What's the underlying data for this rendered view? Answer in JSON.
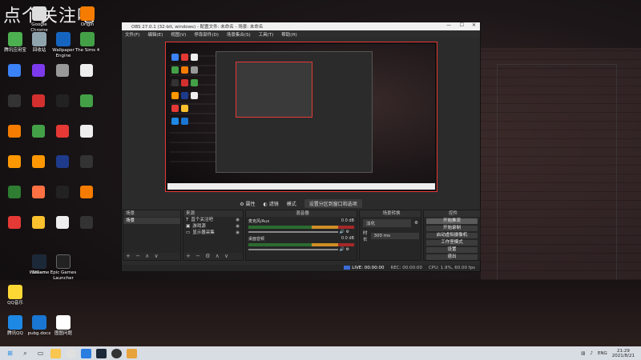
{
  "watermark": "点个关注吧",
  "obs": {
    "title": "OBS 27.0.1 (32-bit, windows) - 配置文件: 未命名 - 场景: 未命名",
    "menu": [
      "文件(F)",
      "编辑(E)",
      "视图(V)",
      "停靠部件(D)",
      "场景集合(S)",
      "工具(T)",
      "帮助(H)"
    ],
    "midbar": [
      "属性",
      "滤镜",
      "模式",
      "设置分区到窗口和选项"
    ],
    "scenes": {
      "header": "场景",
      "items": [
        "场景"
      ],
      "footer": "+ − ∧ ∨"
    },
    "sources": {
      "header": "来源",
      "items": [
        "直个关注吧",
        "游戏源",
        "显示器采集"
      ],
      "footer": "+ − ⚙ ∧ ∨"
    },
    "mixer": {
      "header": "混音器",
      "tracks": [
        {
          "name": "麦克风/Aux",
          "db": "0.0 dB"
        },
        {
          "name": "桌面音频",
          "db": "0.0 dB"
        }
      ]
    },
    "transitions": {
      "header": "场景转换",
      "type": "淡化",
      "duration_label": "时长",
      "duration": "300 ms"
    },
    "controls": {
      "header": "控件",
      "buttons": [
        "开始推流",
        "开始录制",
        "启动虚拟摄像机",
        "工作室模式",
        "设置",
        "退出"
      ]
    },
    "status": {
      "live": "LIVE: 00:00:00",
      "rec": "REC: 00:00:00",
      "cpu": "CPU: 1.9%, 60.00 fps"
    }
  },
  "desktop_icons": [
    {
      "label": "Google Chrome",
      "color": "#e0e0e0"
    },
    {
      "label": "Origin",
      "color": "#f57c00"
    },
    {
      "label": "腾讯应用宝",
      "color": "#4caf50"
    },
    {
      "label": "回收站",
      "color": "#90a4ae"
    },
    {
      "label": "Wallpaper Engine",
      "color": "#1565c0"
    },
    {
      "label": "The Sims 4",
      "color": "#43a047"
    },
    {
      "label": "WeGame",
      "color": "#e53935"
    },
    {
      "label": "Steam",
      "color": "#1b2838"
    },
    {
      "label": "Epic Games Launcher",
      "color": "#222"
    },
    {
      "label": "QQ音乐",
      "color": "#fdd835"
    },
    {
      "label": "腾讯QQ",
      "color": "#1e88e5"
    },
    {
      "label": "pubg.docx",
      "color": "#1976d2"
    },
    {
      "label": "图图问题",
      "color": "#ffffff"
    }
  ],
  "taskbar": {
    "lang": "ENG",
    "time": "21:29",
    "date": "2021/8/21"
  }
}
